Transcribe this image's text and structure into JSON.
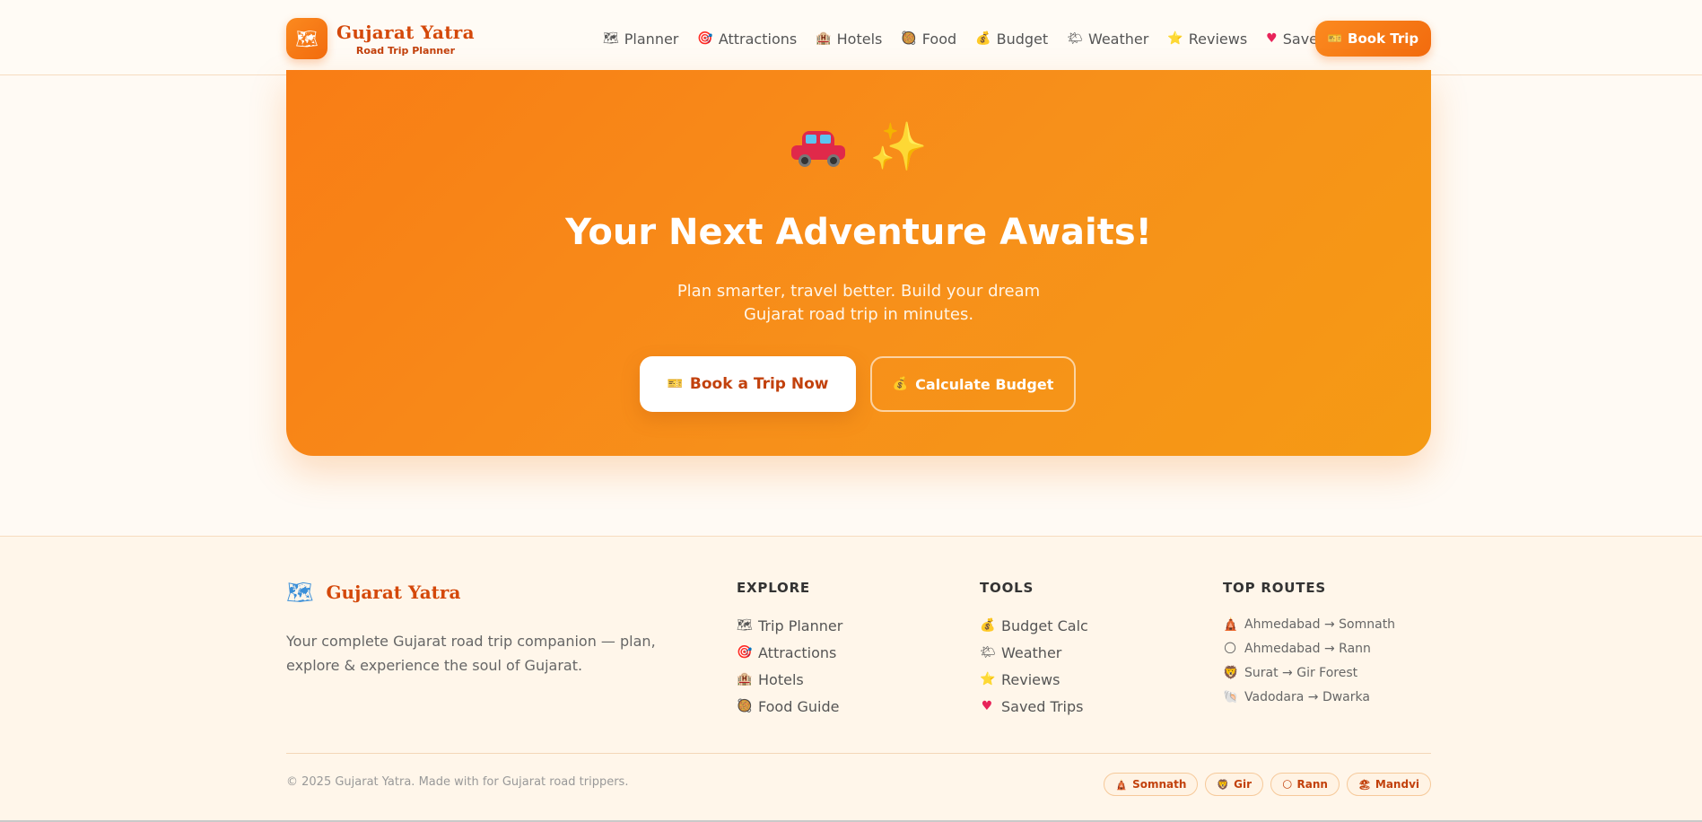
{
  "header": {
    "brand_title": "Gujarat Yatra",
    "brand_subtitle": "Road Trip Planner",
    "nav": [
      {
        "icon": "🗺",
        "label": "Planner"
      },
      {
        "icon": "🎯",
        "label": "Attractions"
      },
      {
        "icon": "🏨",
        "label": "Hotels"
      },
      {
        "icon": "🥘",
        "label": "Food"
      },
      {
        "icon": "💰",
        "label": "Budget"
      },
      {
        "icon": "🌤",
        "label": "Weather"
      },
      {
        "icon": "⭐",
        "label": "Reviews"
      },
      {
        "icon": "♥",
        "label": "Saved"
      }
    ],
    "book_icon": "🎫",
    "book_label": "Book Trip"
  },
  "hero": {
    "sparkle_glyph": "✨",
    "title": "Your Next Adventure Awaits!",
    "subtitle": "Plan smarter, travel better. Build your dream Gujarat road trip in minutes.",
    "primary_icon": "🎫",
    "primary_label": "Book a Trip Now",
    "secondary_icon": "💰",
    "secondary_label": "Calculate Budget"
  },
  "footer": {
    "brand_icon": "🗺",
    "brand_title": "Gujarat Yatra",
    "description": "Your complete Gujarat road trip companion — plan, explore & experience the soul of Gujarat.",
    "explore_heading": "EXPLORE",
    "explore": [
      {
        "icon": "🗺",
        "label": "Trip Planner"
      },
      {
        "icon": "🎯",
        "label": "Attractions"
      },
      {
        "icon": "🏨",
        "label": "Hotels"
      },
      {
        "icon": "🥘",
        "label": "Food Guide"
      }
    ],
    "tools_heading": "TOOLS",
    "tools": [
      {
        "icon": "💰",
        "label": "Budget Calc"
      },
      {
        "icon": "🌤",
        "label": "Weather"
      },
      {
        "icon": "⭐",
        "label": "Reviews"
      },
      {
        "icon": "♥",
        "label": "Saved Trips"
      }
    ],
    "routes_heading": "TOP ROUTES",
    "routes": [
      {
        "icon": "🛕",
        "label": "Ahmedabad → Somnath"
      },
      {
        "icon": "🌕",
        "label": "Ahmedabad → Rann"
      },
      {
        "icon": "🦁",
        "label": "Surat → Gir Forest"
      },
      {
        "icon": "🐚",
        "label": "Vadodara → Dwarka"
      }
    ],
    "copyright": "© 2025 Gujarat Yatra. Made with for Gujarat road trippers.",
    "tags": [
      {
        "icon": "🛕",
        "label": "Somnath"
      },
      {
        "icon": "🦁",
        "label": "Gir"
      },
      {
        "icon": "🌕",
        "label": "Rann"
      },
      {
        "icon": "🏖",
        "label": "Mandvi"
      }
    ]
  }
}
